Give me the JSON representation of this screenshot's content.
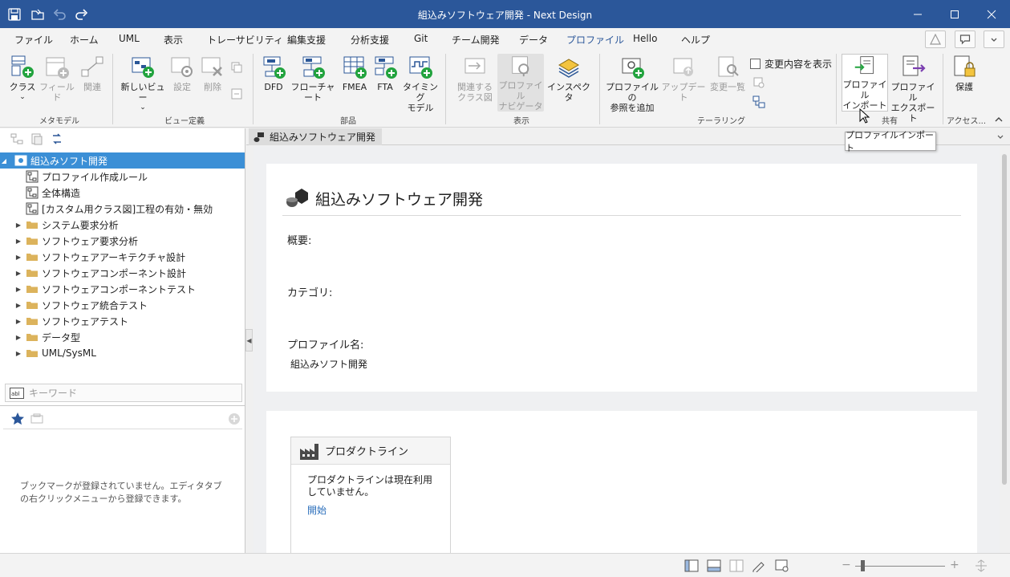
{
  "window": {
    "title": "組込みソフトウェア開発 - Next Design"
  },
  "menu": {
    "items": [
      "ファイル",
      "ホーム",
      "UML",
      "表示",
      "トレーサビリティ",
      "編集支援",
      "分析支援",
      "Git",
      "チーム開発",
      "データ",
      "プロファイル",
      "Hello",
      "ヘルプ"
    ],
    "active": "プロファイル"
  },
  "ribbon": {
    "metamodel": {
      "class_l1": "クラス",
      "field": "フィールド",
      "relation": "関連",
      "group": "メタモデル"
    },
    "viewdef": {
      "newview_l1": "新しいビュー",
      "settings": "設定",
      "delete": "削除",
      "group": "ビュー定義"
    },
    "parts": {
      "dfd": "DFD",
      "flowchart": "フローチャート",
      "fmea": "FMEA",
      "fta": "FTA",
      "timing_l1": "タイミング",
      "timing_l2": "モデル",
      "group": "部品"
    },
    "display": {
      "related_l1": "関連する",
      "related_l2": "クラス図",
      "navigator_l1": "プロファイル",
      "navigator_l2": "ナビゲータ",
      "inspector": "インスペクタ",
      "group": "表示"
    },
    "tailoring": {
      "addref_l1": "プロファイルの",
      "addref_l2": "参照を追加",
      "update": "アップデート",
      "changelist": "変更一覧",
      "show_changes": "変更内容を表示",
      "group": "テーラリング"
    },
    "share": {
      "import_l1": "プロファイル",
      "import_l2": "インポート",
      "export_l1": "プロファイル",
      "export_l2": "エクスポート",
      "group": "共有"
    },
    "access": {
      "protect": "保護",
      "group": "アクセス..."
    }
  },
  "tooltip": "プロファイルインポート",
  "tree": {
    "root": "組込みソフト開発",
    "items": [
      {
        "label": "プロファイル作成ルール",
        "type": "diagram"
      },
      {
        "label": "全体構造",
        "type": "diagram"
      },
      {
        "label": "[カスタム用クラス図]工程の有効・無効",
        "type": "diagram"
      },
      {
        "label": "システム要求分析",
        "type": "folder"
      },
      {
        "label": "ソフトウェア要求分析",
        "type": "folder"
      },
      {
        "label": "ソフトウェアアーキテクチャ設計",
        "type": "folder"
      },
      {
        "label": "ソフトウェアコンポーネント設計",
        "type": "folder"
      },
      {
        "label": "ソフトウェアコンポーネントテスト",
        "type": "folder"
      },
      {
        "label": "ソフトウェア統合テスト",
        "type": "folder"
      },
      {
        "label": "ソフトウェアテスト",
        "type": "folder"
      },
      {
        "label": "データ型",
        "type": "folder"
      },
      {
        "label": "UML/SysML",
        "type": "folder"
      }
    ]
  },
  "search": {
    "placeholder": "キーワード"
  },
  "bookmarks": {
    "empty_text": "ブックマークが登録されていません。エディタタブの右クリックメニューから登録できます。"
  },
  "document": {
    "tab": "組込みソフトウェア開発",
    "heading": "組込みソフトウェア開発",
    "overview_label": "概要:",
    "category_label": "カテゴリ:",
    "profile_name_label": "プロファイル名:",
    "profile_name_value": "組込みソフト開発"
  },
  "productline": {
    "title": "プロダクトライン",
    "desc": "プロダクトラインは現在利用していません。",
    "start_link": "開始"
  },
  "colors": {
    "accent": "#2b579a",
    "selection": "#3b8fd6",
    "link": "#2a6ebb",
    "folder": "#dcb35c"
  }
}
